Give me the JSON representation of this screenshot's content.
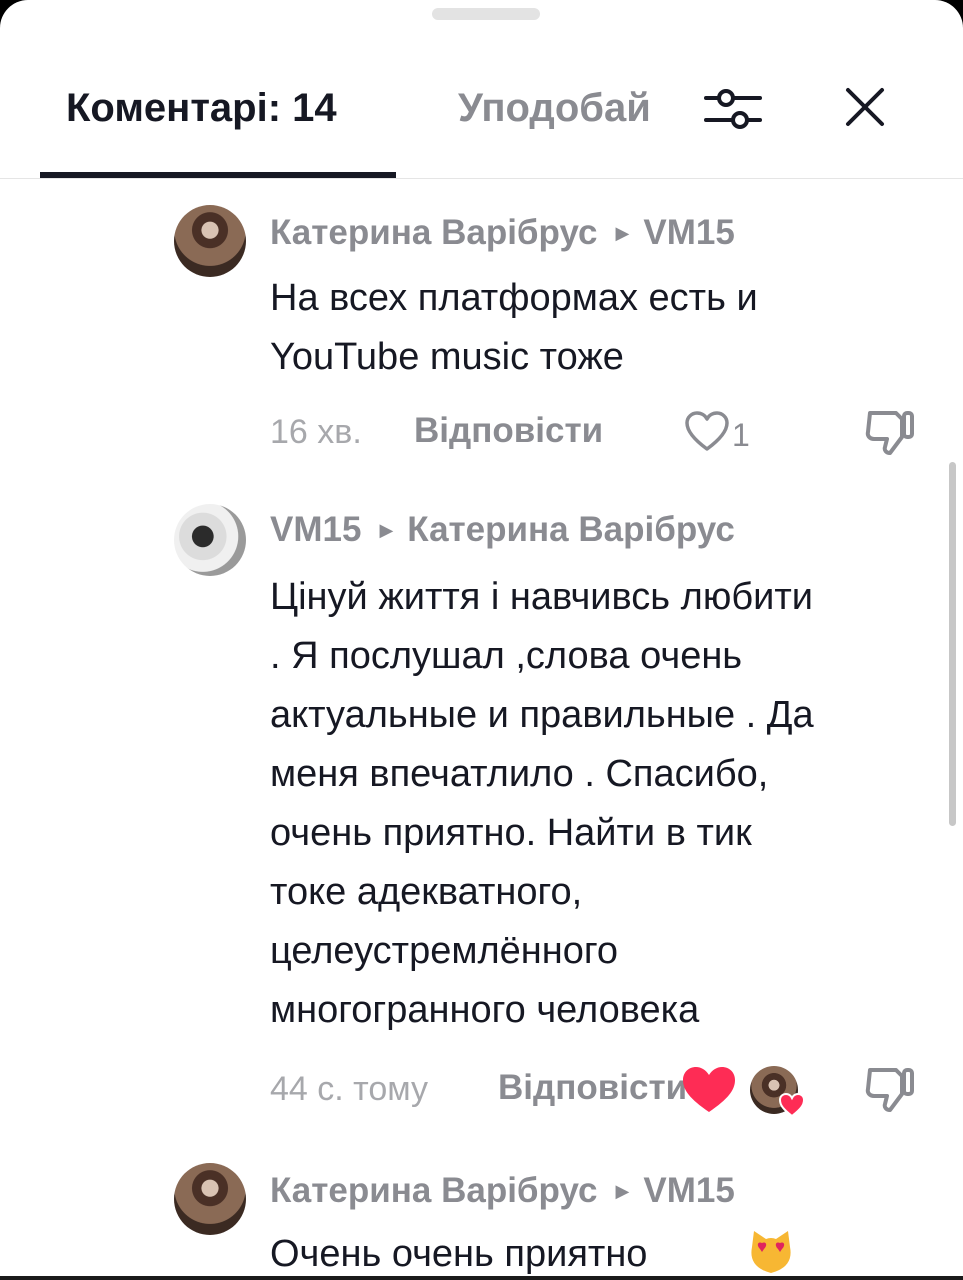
{
  "tabs": {
    "comments_label": "Коментарі: 14",
    "likes_label": "Уподобай"
  },
  "icons": {
    "filter": "filter-sliders-icon",
    "close": "close-icon",
    "like": "heart-outline-icon",
    "dislike": "thumbs-down-icon",
    "reply_arrow": "triangle-right-icon",
    "emoji": "heart-eyes-cat-emoji"
  },
  "comments": [
    {
      "author": "Катерина Варібрус",
      "reply_to": "VM15",
      "text": "На всех платформах есть и\nYouTube music тоже",
      "time": "16 хв.",
      "reply_label": "Відповісти",
      "likes": "1"
    },
    {
      "author": "VM15",
      "reply_to": "Катерина Варібрус",
      "text": "Цінуй життя і навчивсь любити\n. Я послушал ,слова очень\nактуальные и правильные . Да\nменя впечатлило . Спасибо,\nочень приятно. Найти в тик\nтоке адекватного,\nцелеустремлённого\nмногогранного человека",
      "time": "44 с. тому",
      "reply_label": "Відповісти"
    },
    {
      "author": "Катерина Варібрус",
      "reply_to": "VM15",
      "text": "Очень очень приятно"
    }
  ],
  "colors": {
    "heart": "#fe2c55",
    "text_primary": "#161823",
    "text_secondary": "#8a8b91"
  }
}
